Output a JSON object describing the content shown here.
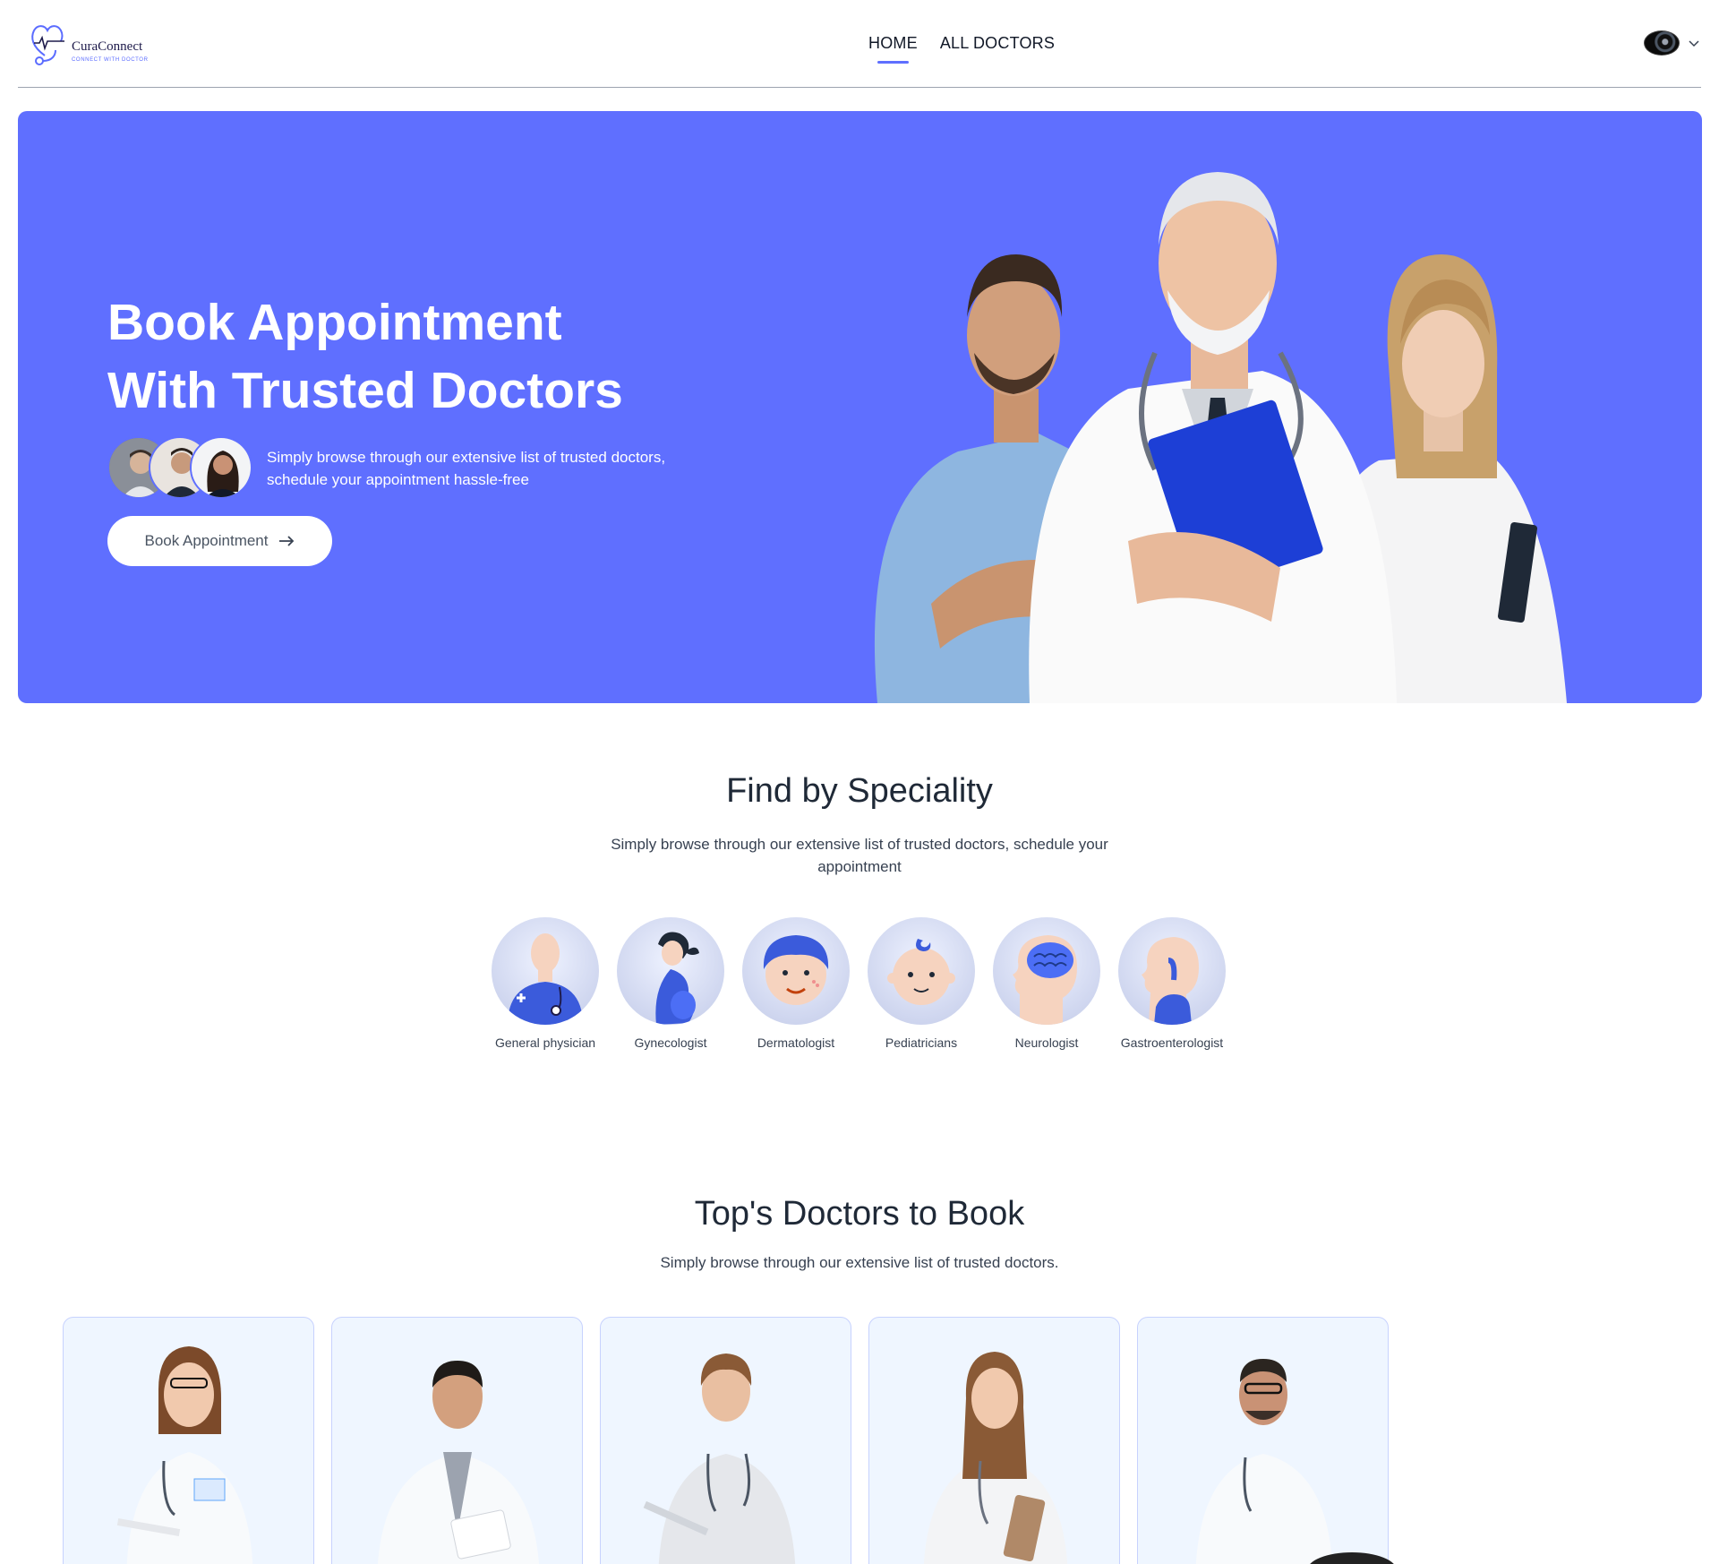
{
  "navbar": {
    "logo": {
      "name": "CuraConnect",
      "tagline": "CONNECT WITH DOCTOR"
    },
    "links": [
      {
        "label": "HOME",
        "active": true
      },
      {
        "label": "ALL DOCTORS",
        "active": false
      }
    ],
    "profile_icon": "user-avatar",
    "dropdown_icon": "chevron-down-icon"
  },
  "hero": {
    "title_line1": "Book Appointment",
    "title_line2": "With Trusted Doctors",
    "subtitle_line1": "Simply browse through our extensive list of trusted doctors,",
    "subtitle_line2": "schedule your appointment hassle-free",
    "button_label": "Book Appointment",
    "button_icon": "arrow-right-icon",
    "background_color": "#5f6fff"
  },
  "speciality": {
    "title": "Find by Speciality",
    "subtitle_line1": "Simply browse through our extensive list of trusted doctors, schedule your",
    "subtitle_line2": "appointment",
    "items": [
      {
        "label": "General physician",
        "icon": "general-physician-icon"
      },
      {
        "label": "Gynecologist",
        "icon": "gynecologist-icon"
      },
      {
        "label": "Dermatologist",
        "icon": "dermatologist-icon"
      },
      {
        "label": "Pediatricians",
        "icon": "pediatrician-icon"
      },
      {
        "label": "Neurologist",
        "icon": "neurologist-icon"
      },
      {
        "label": "Gastroenterologist",
        "icon": "gastroenterologist-icon"
      }
    ]
  },
  "top_doctors": {
    "title": "Top's Doctors to Book",
    "subtitle": "Simply browse through our extensive list of trusted doctors."
  },
  "colors": {
    "accent": "#5f6fff",
    "card_bg": "#eff6ff",
    "card_border": "#c7d2fe"
  }
}
